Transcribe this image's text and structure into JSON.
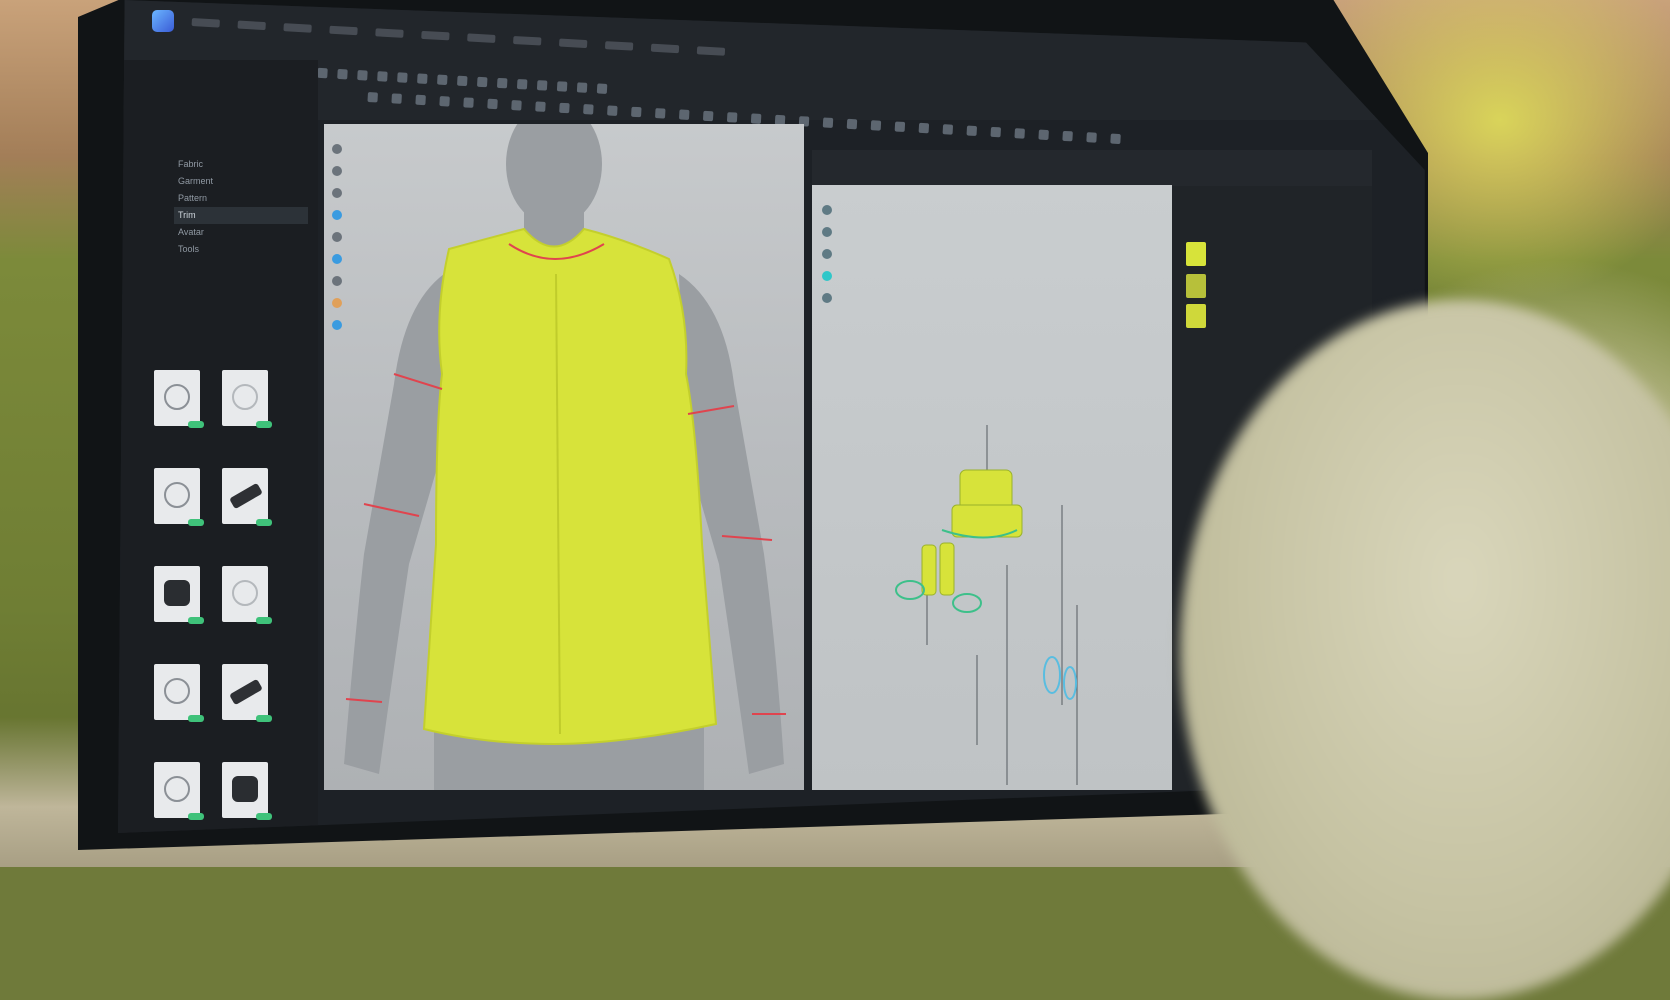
{
  "app": {
    "accent": "#3a9be0",
    "garment_color": "#d7e33a",
    "seam_color": "#e0444e"
  },
  "menu": {
    "items": [
      "",
      "",
      "",
      "",
      "",
      "",
      "",
      "",
      "",
      "",
      "",
      ""
    ]
  },
  "sidebar": {
    "library_items": [
      "Fabric",
      "Garment",
      "Pattern",
      "Trim",
      "Avatar",
      "Tools"
    ],
    "selected_index": 3
  },
  "thumbnails": [
    {
      "kind": "button"
    },
    {
      "kind": "faint"
    },
    {
      "kind": "loop"
    },
    {
      "kind": "stick"
    },
    {
      "kind": "dark"
    },
    {
      "kind": "faint"
    },
    {
      "kind": "button"
    },
    {
      "kind": "stick"
    },
    {
      "kind": "button"
    },
    {
      "kind": "dark"
    }
  ],
  "status": {
    "text": ""
  }
}
